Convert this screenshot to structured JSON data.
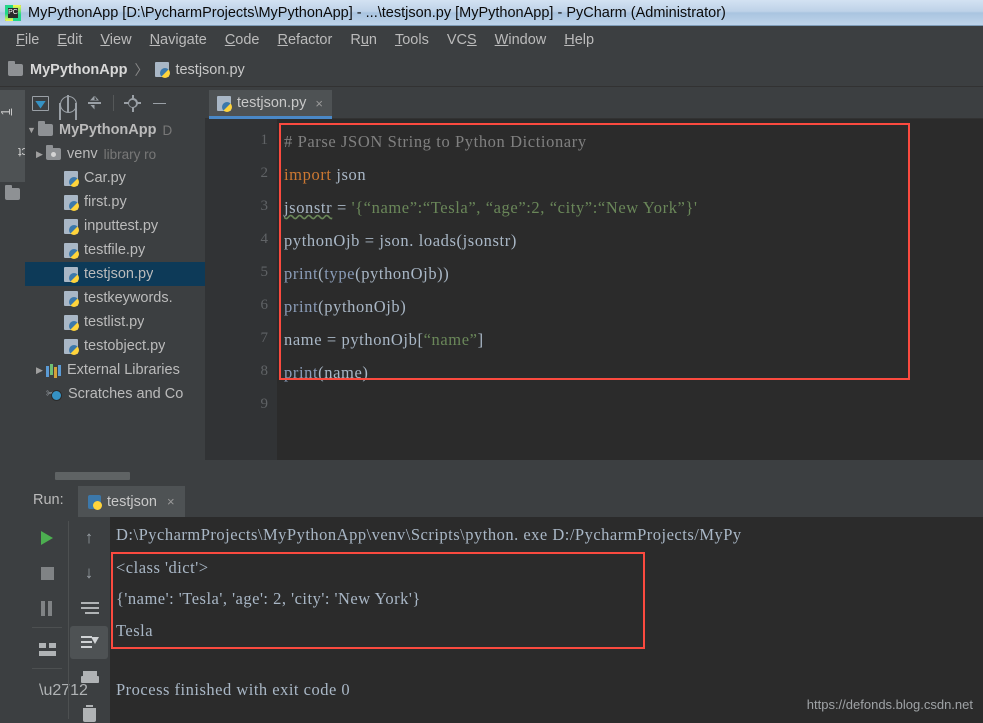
{
  "window": {
    "title": "MyPythonApp [D:\\PycharmProjects\\MyPythonApp] - ...\\testjson.py [MyPythonApp] - PyCharm (Administrator)",
    "app_icon": "pycharm-icon",
    "icon_text": "PC"
  },
  "menubar": {
    "items": [
      {
        "label": "File",
        "mnemonic": "F",
        "rest": "ile"
      },
      {
        "label": "Edit",
        "mnemonic": "E",
        "rest": "dit"
      },
      {
        "label": "View",
        "mnemonic": "V",
        "rest": "iew"
      },
      {
        "label": "Navigate",
        "mnemonic": "N",
        "rest": "avigate"
      },
      {
        "label": "Code",
        "mnemonic": "C",
        "rest": "ode"
      },
      {
        "label": "Refactor",
        "mnemonic": "R",
        "rest": "efactor"
      },
      {
        "label": "Run",
        "mnemonic": "R",
        "rest": "un"
      },
      {
        "label": "Tools",
        "mnemonic": "T",
        "rest": "ools"
      },
      {
        "label": "VCS",
        "mnemonic": "VCS",
        "rest": ""
      },
      {
        "label": "Window",
        "mnemonic": "W",
        "rest": "indow"
      },
      {
        "label": "Help",
        "mnemonic": "H",
        "rest": "elp"
      }
    ]
  },
  "breadcrumb": {
    "project": "MyPythonApp",
    "separator": "〉",
    "file": "testjson.py"
  },
  "tool_window": {
    "vertical_tab": "1: Project",
    "vertical_tab_mnemonic": "1",
    "vertical_tab_rest": ": Project"
  },
  "project_toolbar": {
    "icons": [
      "select-opened-file-icon",
      "locate-target-icon",
      "collapse-all-icon",
      "settings-gear-icon",
      "hide-panel-icon"
    ]
  },
  "project_tree": {
    "items": [
      {
        "label": "MyPythonApp",
        "sub": "D",
        "icon": "folder-icon",
        "arrow": "▼",
        "indent": 0,
        "selected": false,
        "bold": true
      },
      {
        "label": "venv",
        "sub": "library ro",
        "icon": "folder-venv-icon",
        "arrow": "▶",
        "indent": 1,
        "selected": false,
        "bold": false
      },
      {
        "label": "Car.py",
        "sub": "",
        "icon": "python-file-icon",
        "arrow": "",
        "indent": 2,
        "selected": false,
        "bold": false
      },
      {
        "label": "first.py",
        "sub": "",
        "icon": "python-file-icon",
        "arrow": "",
        "indent": 2,
        "selected": false,
        "bold": false
      },
      {
        "label": "inputtest.py",
        "sub": "",
        "icon": "python-file-icon",
        "arrow": "",
        "indent": 2,
        "selected": false,
        "bold": false
      },
      {
        "label": "testfile.py",
        "sub": "",
        "icon": "python-file-icon",
        "arrow": "",
        "indent": 2,
        "selected": false,
        "bold": false
      },
      {
        "label": "testjson.py",
        "sub": "",
        "icon": "python-file-icon",
        "arrow": "",
        "indent": 2,
        "selected": true,
        "bold": false
      },
      {
        "label": "testkeywords.",
        "sub": "",
        "icon": "python-file-icon",
        "arrow": "",
        "indent": 2,
        "selected": false,
        "bold": false
      },
      {
        "label": "testlist.py",
        "sub": "",
        "icon": "python-file-icon",
        "arrow": "",
        "indent": 2,
        "selected": false,
        "bold": false
      },
      {
        "label": "testobject.py",
        "sub": "",
        "icon": "python-file-icon",
        "arrow": "",
        "indent": 2,
        "selected": false,
        "bold": false
      },
      {
        "label": "External Libraries",
        "sub": "",
        "icon": "libraries-icon",
        "arrow": "▶",
        "indent": 1,
        "selected": false,
        "bold": false
      },
      {
        "label": "Scratches and Co",
        "sub": "",
        "icon": "scratches-icon",
        "arrow": "",
        "indent": 1,
        "selected": false,
        "bold": false
      }
    ]
  },
  "editor": {
    "tab": {
      "label": "testjson.py",
      "close": "×",
      "icon": "python-file-icon",
      "active_underline_color": "#4a88c7"
    },
    "line_numbers": [
      "1",
      "2",
      "3",
      "4",
      "5",
      "6",
      "7",
      "8",
      "9"
    ],
    "code_lines": [
      {
        "n": 1,
        "tokens": [
          {
            "t": "# Parse JSON String to Python Dictionary",
            "c": "c-comment"
          }
        ]
      },
      {
        "n": 2,
        "tokens": [
          {
            "t": "import",
            "c": "c-kw"
          },
          {
            "t": " json",
            "c": "c-plain"
          }
        ]
      },
      {
        "n": 3,
        "tokens": [
          {
            "t": "jsonstr",
            "c": "c-plain squiggle"
          },
          {
            "t": " = ",
            "c": "c-plain"
          },
          {
            "t": "'{“name”:“Tesla”, “age”:2, “city”:“New York”}'",
            "c": "c-str"
          }
        ]
      },
      {
        "n": 4,
        "tokens": [
          {
            "t": "pythonOjb = json. loads(jsonstr)",
            "c": "c-plain"
          }
        ]
      },
      {
        "n": 5,
        "tokens": [
          {
            "t": "print",
            "c": "c-func"
          },
          {
            "t": "(",
            "c": "c-plain"
          },
          {
            "t": "type",
            "c": "c-func"
          },
          {
            "t": "(pythonOjb))",
            "c": "c-plain"
          }
        ]
      },
      {
        "n": 6,
        "tokens": [
          {
            "t": "print",
            "c": "c-func"
          },
          {
            "t": "(pythonOjb)",
            "c": "c-plain"
          }
        ]
      },
      {
        "n": 7,
        "tokens": [
          {
            "t": "name = pythonOjb[",
            "c": "c-plain"
          },
          {
            "t": "“name”",
            "c": "c-str"
          },
          {
            "t": "]",
            "c": "c-plain"
          }
        ]
      },
      {
        "n": 8,
        "tokens": [
          {
            "t": "print",
            "c": "c-func"
          },
          {
            "t": "(name)",
            "c": "c-plain"
          }
        ]
      },
      {
        "n": 9,
        "tokens": []
      }
    ],
    "annotation_color": "#fb4a3f"
  },
  "run_panel": {
    "label": "Run:",
    "tab": {
      "label": "testjson",
      "close": "×",
      "icon": "python-file-icon"
    },
    "left_icons": [
      "run-play-icon",
      "stop-icon",
      "pause-icon",
      "layout-toggle-icon",
      "pin-tab-icon"
    ],
    "right_icons": [
      "up-arrow-icon",
      "down-arrow-icon",
      "soft-wrap-icon",
      "scroll-to-end-icon",
      "print-icon",
      "trash-icon"
    ],
    "console_lines": [
      {
        "text": "D:\\PycharmProjects\\MyPythonApp\\venv\\Scripts\\python. exe D:/PycharmProjects/MyPy"
      },
      {
        "text": "<class 'dict'>"
      },
      {
        "text": "{'name': 'Tesla', 'age': 2, 'city': 'New York'}"
      },
      {
        "text": "Tesla"
      },
      {
        "text": "Process finished with exit code 0"
      }
    ]
  },
  "watermark": {
    "text": "https://defonds.blog.csdn.net"
  }
}
